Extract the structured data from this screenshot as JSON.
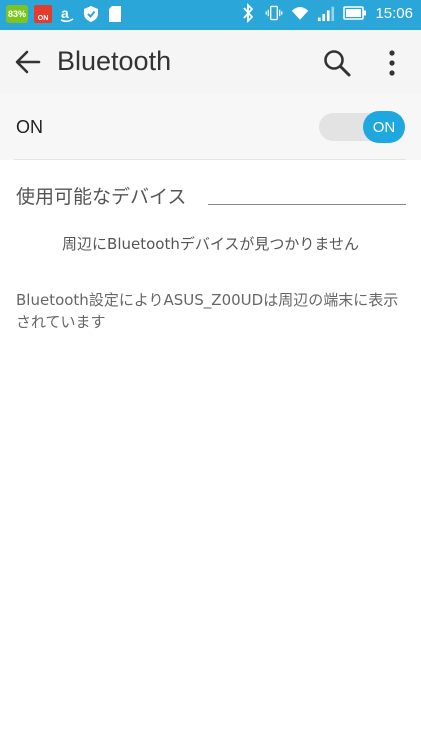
{
  "status_bar": {
    "battery_badge": "83%",
    "on_badge": "ON",
    "time": "15:06",
    "icons": [
      "amazon-icon",
      "shield-icon",
      "sd-card-icon",
      "bluetooth-icon",
      "vibrate-icon",
      "wifi-icon",
      "signal-icon",
      "battery-icon"
    ]
  },
  "app_bar": {
    "title": "Bluetooth",
    "icons": [
      "back-arrow-icon",
      "search-icon",
      "more-vert-icon"
    ]
  },
  "toggle_row": {
    "label": "ON",
    "switch_label": "ON",
    "state": true,
    "accent": "#1fa8e0"
  },
  "devices": {
    "section_title": "使用可能なデバイス",
    "empty_message": "周辺にBluetoothデバイスが見つかりません",
    "visibility_message": "Bluetooth設定によりASUS_Z00UDは周辺の端末に表示されています"
  },
  "colors": {
    "status_bar": "#2aa6d9",
    "app_bar": "#f5f5f5",
    "battery_badge": "#7cc521",
    "on_badge": "#e23c2c"
  }
}
